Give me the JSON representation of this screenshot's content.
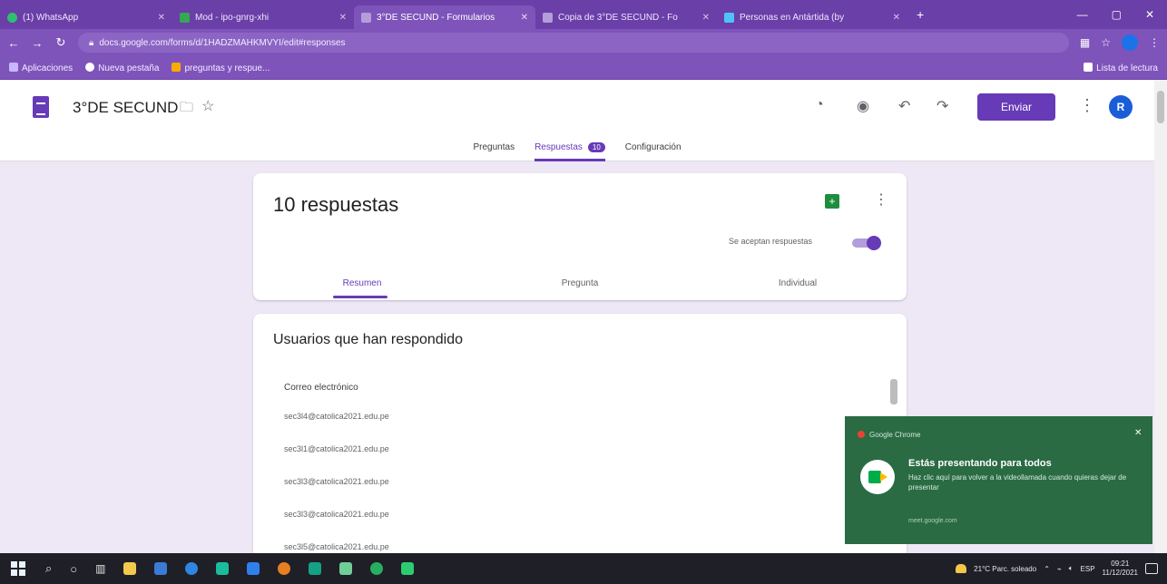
{
  "browser": {
    "tabs": [
      {
        "label": "(1) WhatsApp",
        "active": false
      },
      {
        "label": "Mod - ipo-gnrg-xhi",
        "active": false
      },
      {
        "label": "3°DE SECUND - Formularios",
        "active": true
      },
      {
        "label": "Copia de 3°DE SECUND - Fo",
        "active": false
      },
      {
        "label": "Personas en Antártida (by",
        "active": false
      }
    ],
    "new_tab": "+",
    "window_controls": [
      "—",
      "▢",
      "✕"
    ],
    "url": "docs.google.com/forms/d/1HADZMAHKMVYI/edit#responses",
    "bookmarks": [
      {
        "label": "Aplicaciones",
        "color": "#c8b6ff"
      },
      {
        "label": "Nueva pestaña",
        "color": "#ffffff"
      },
      {
        "label": "preguntas y respue...",
        "color": "#f9ab00"
      }
    ],
    "bookmarks_right": "Lista de lectura"
  },
  "form": {
    "title": "3°DE SECUND",
    "send_label": "Enviar",
    "avatar_letter": "R",
    "tabs": [
      {
        "label": "Preguntas",
        "active": false
      },
      {
        "label": "Respuestas",
        "active": true,
        "badge": "10"
      },
      {
        "label": "Configuración",
        "active": false
      }
    ]
  },
  "summary": {
    "count_title": "10 respuestas",
    "accept_label": "Se aceptan respuestas",
    "accepting": true,
    "subtabs": [
      {
        "label": "Resumen",
        "active": true
      },
      {
        "label": "Pregunta",
        "active": false
      },
      {
        "label": "Individual",
        "active": false
      }
    ]
  },
  "respondents": {
    "title": "Usuarios que han respondido",
    "header": "Correo electrónico",
    "emails": [
      "sec3l4@catolica2021.edu.pe",
      "sec3l1@catolica2021.edu.pe",
      "sec3l3@catolica2021.edu.pe",
      "sec3l3@catolica2021.edu.pe",
      "sec3l5@catolica2021.edu.pe"
    ]
  },
  "notification": {
    "app": "Google Chrome",
    "title": "Estás presentando para todos",
    "body": "Haz clic aquí para volver a la videollamada cuando quieras dejar de presentar",
    "source": "meet.google.com"
  },
  "taskbar": {
    "weather": "21°C Parc. soleado",
    "language": "ESP",
    "time": "09:21",
    "date": "11/12/2021",
    "app_colors": [
      "#f2c94c",
      "#3a7bd5",
      "#2e86de",
      "#1abc9c",
      "#2f80ed",
      "#e67e22",
      "#16a085",
      "#6fcf97",
      "#27ae60",
      "#2ecc71"
    ]
  },
  "colors": {
    "accent": "#673ab7",
    "browser": "#7e54bb",
    "notification": "#2a6b44"
  }
}
